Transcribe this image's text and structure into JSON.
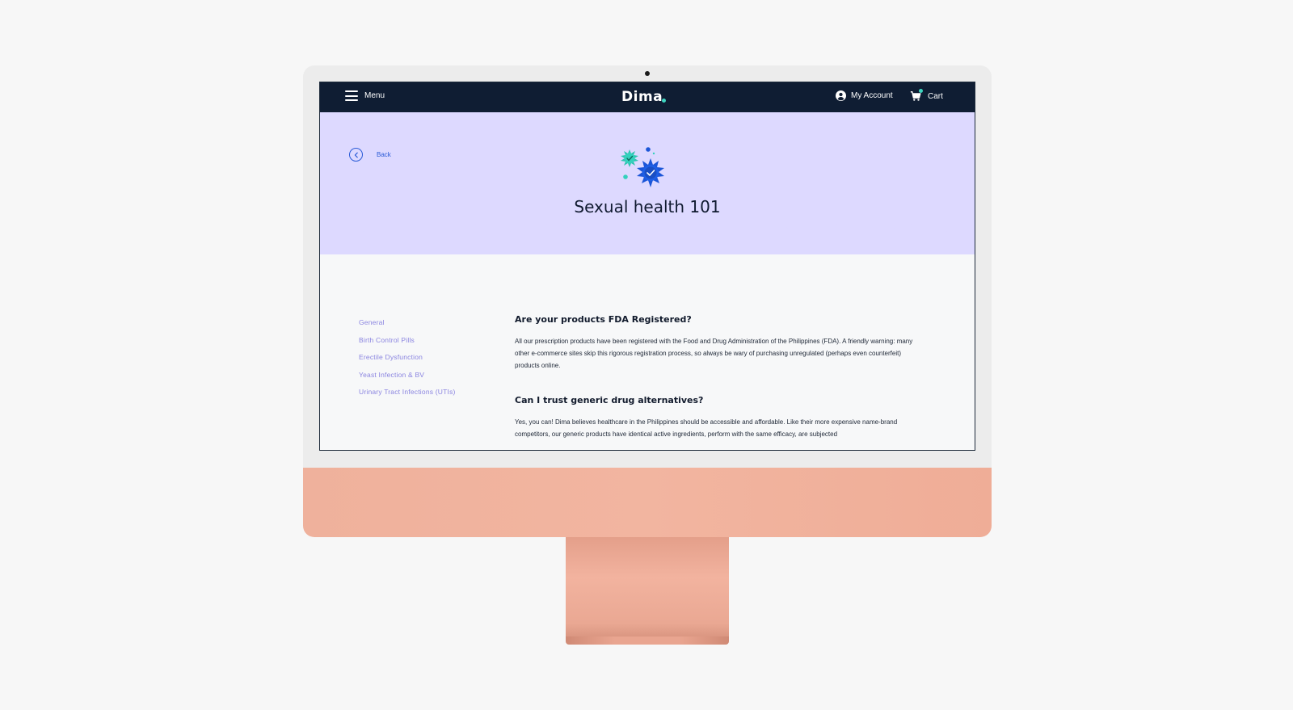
{
  "nav": {
    "menu_label": "Menu",
    "logo_text": "Dim",
    "logo_tail": "a",
    "account_label": "My Account",
    "cart_label": "Cart"
  },
  "hero": {
    "back_label": "Back",
    "title": "Sexual health 101",
    "background_color": "#ddd9ff"
  },
  "sidebar": {
    "items": [
      {
        "label": "General"
      },
      {
        "label": "Birth Control Pills"
      },
      {
        "label": "Erectile Dysfunction"
      },
      {
        "label": "Yeast Infection & BV"
      },
      {
        "label": "Urinary Tract Infections (UTIs)"
      }
    ]
  },
  "faq": {
    "items": [
      {
        "question": "Are your products FDA Registered?",
        "answer": "All our prescription products have been registered with the Food and Drug Administration of the Philippines (FDA). A friendly warning: many other e-commerce sites skip this rigorous registration process, so always be wary of purchasing unregulated (perhaps even counterfeit) products online."
      },
      {
        "question": "Can I trust generic drug alternatives?",
        "answer": "Yes, you can! Dima believes healthcare in the Philippines should be accessible and affordable. Like their more expensive name-brand competitors, our generic products have identical active ingredients, perform with the same efficacy, are subjected"
      }
    ]
  },
  "colors": {
    "nav_bg": "#0f1d33",
    "accent_teal": "#3ed6c1",
    "accent_blue": "#2a5bd7",
    "sidebar_link": "#8a84e0"
  },
  "icons": [
    "hamburger-icon",
    "user-circle-icon",
    "cart-icon",
    "chevron-left-icon",
    "virus-check-illustration"
  ]
}
